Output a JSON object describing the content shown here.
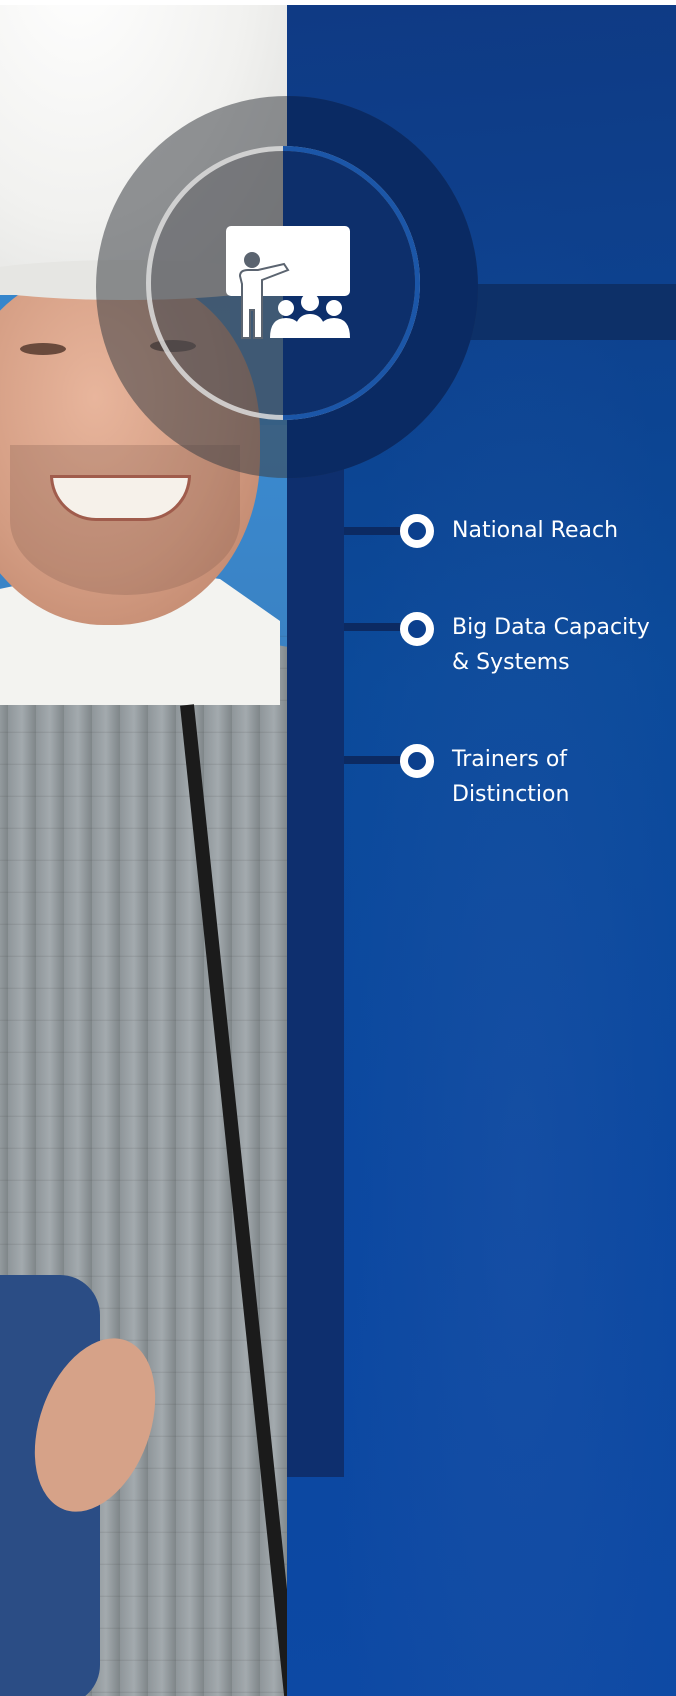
{
  "features": {
    "items": [
      {
        "label": "National Reach"
      },
      {
        "label": "Big Data Capacity\n& Systems"
      },
      {
        "label": "Trainers of\nDistinction"
      }
    ]
  },
  "colors": {
    "panel_blue": "#0b4a9a",
    "dark_navy": "#0e2f6e",
    "text": "#ffffff"
  },
  "icons": {
    "badge": "presentation-icon",
    "bullet": "ring-bullet-icon"
  }
}
